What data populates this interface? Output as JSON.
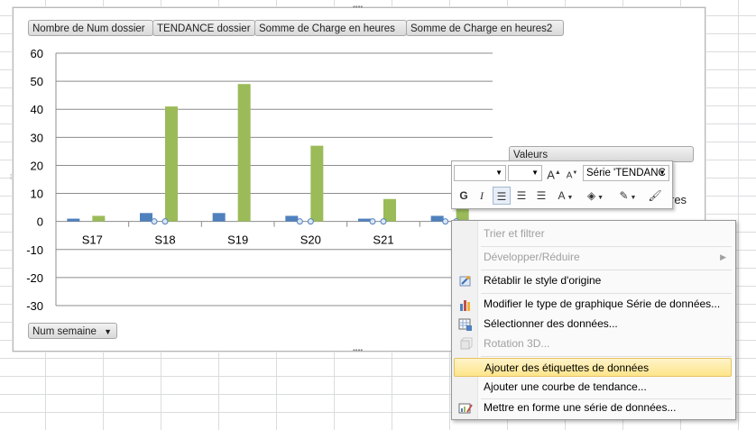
{
  "chart": {
    "field_buttons": {
      "count_num_dossier": "Nombre de Num dossier",
      "tendance_dossier": "TENDANCE dossier",
      "sum_charge_heures": "Somme de Charge en heures",
      "sum_charge_heures2": "Somme de Charge en heures2",
      "num_semaine": "Num semaine",
      "valeurs": "Valeurs"
    },
    "legend_fragment": "res"
  },
  "chart_data": {
    "type": "bar",
    "categories": [
      "S17",
      "S18",
      "S19",
      "S20",
      "S21",
      "S"
    ],
    "series": [
      {
        "values": [
          1,
          3,
          3,
          2,
          1,
          2
        ],
        "color": "#4f81bd"
      },
      {
        "values": [
          2,
          41,
          49,
          27,
          8,
          5
        ],
        "color": "#9bbb59"
      }
    ],
    "y_ticks": [
      "60",
      "50",
      "40",
      "30",
      "20",
      "10",
      "0",
      "-10",
      "-20",
      "-30"
    ],
    "ylim": [
      -30,
      60
    ],
    "grid": true
  },
  "minibar": {
    "font_name": "",
    "font_size": "",
    "series_selector": "Série 'TENDANC",
    "bold": "G",
    "italic": "I",
    "grow_font": "A",
    "shrink_font": "A",
    "font_color": "A"
  },
  "context_menu": {
    "items": [
      {
        "label": "Trier et filtrer",
        "disabled": true
      },
      {
        "label": "Développer/Réduire",
        "disabled": true
      },
      {
        "label": "Rétablir le style d'origine",
        "disabled": false
      },
      {
        "label": "Modifier le type de graphique Série de données...",
        "disabled": false
      },
      {
        "label": "Sélectionner des données...",
        "disabled": false
      },
      {
        "label": "Rotation 3D...",
        "disabled": true
      },
      {
        "label": "Ajouter des étiquettes de données",
        "disabled": false
      },
      {
        "label": "Ajouter une courbe de tendance...",
        "disabled": false
      },
      {
        "label": "Mettre en forme une série de données...",
        "disabled": false
      }
    ]
  },
  "colors": {
    "series_blue": "#4f81bd",
    "series_green": "#9bbb59",
    "menu_highlight": "#fde58a"
  }
}
